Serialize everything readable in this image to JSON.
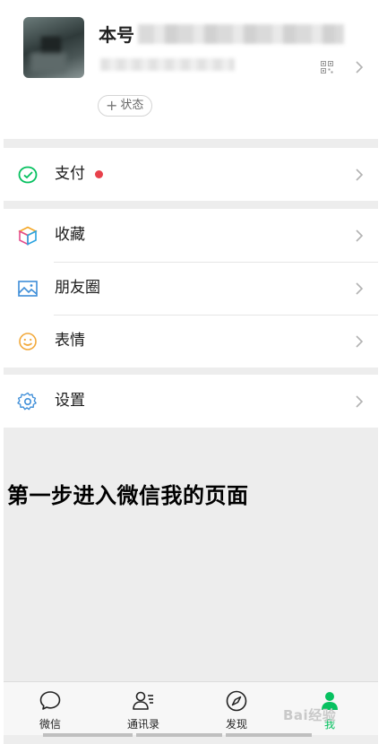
{
  "profile": {
    "nickname_visible": "本号",
    "status_label": "状态"
  },
  "menu": {
    "pay": "支付",
    "favorites": "收藏",
    "moments": "朋友圈",
    "stickers": "表情",
    "settings": "设置"
  },
  "caption": "第一步进入微信我的页面",
  "tabs": [
    {
      "label": "微信",
      "icon": "chat-icon"
    },
    {
      "label": "通讯录",
      "icon": "contacts-icon"
    },
    {
      "label": "发现",
      "icon": "compass-icon"
    },
    {
      "label": "我",
      "icon": "me-icon"
    }
  ],
  "watermark": "Bai经验",
  "colors": {
    "accent": "#07c160",
    "badge": "#e8414b",
    "background": "#ededed"
  }
}
